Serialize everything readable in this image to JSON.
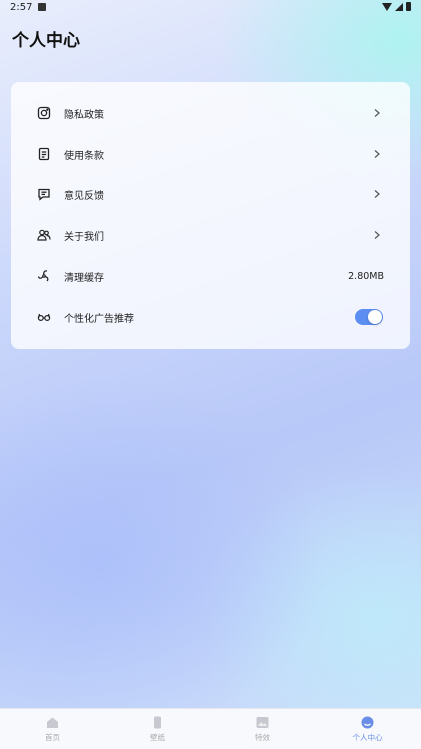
{
  "status_bar": {
    "time": "2:57"
  },
  "header": {
    "title": "个人中心"
  },
  "settings": {
    "items": [
      {
        "label": "隐私政策",
        "icon": "privacy-icon"
      },
      {
        "label": "使用条款",
        "icon": "document-icon"
      },
      {
        "label": "意见反馈",
        "icon": "feedback-icon"
      },
      {
        "label": "关于我们",
        "icon": "people-icon"
      },
      {
        "label": "清理缓存",
        "icon": "fan-icon",
        "value": "2.80MB"
      },
      {
        "label": "个性化广告推荐",
        "icon": "glasses-icon",
        "toggle": true
      }
    ]
  },
  "bottom_nav": {
    "items": [
      {
        "label": "首页",
        "icon": "home-icon"
      },
      {
        "label": "壁纸",
        "icon": "phone-icon"
      },
      {
        "label": "特效",
        "icon": "image-icon"
      },
      {
        "label": "个人中心",
        "icon": "user-icon",
        "active": true
      }
    ]
  },
  "colors": {
    "accent": "#5b8ef0",
    "nav_active": "#6a8de8"
  }
}
